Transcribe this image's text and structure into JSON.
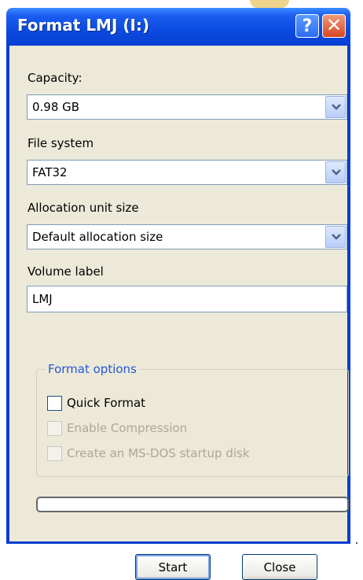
{
  "window": {
    "title": "Format LMJ (I:)",
    "help_glyph": "?",
    "close_glyph": "✕"
  },
  "capacity": {
    "label": "Capacity:",
    "value": "0.98 GB"
  },
  "file_system": {
    "label": "File system",
    "value": "FAT32"
  },
  "allocation": {
    "label": "Allocation unit size",
    "value": "Default allocation size"
  },
  "volume": {
    "label": "Volume label",
    "value": "LMJ"
  },
  "options": {
    "title": "Format options",
    "quick_format": {
      "label": "Quick Format",
      "checked": false,
      "enabled": true
    },
    "compression": {
      "label": "Enable Compression",
      "checked": false,
      "enabled": false
    },
    "msdos": {
      "label": "Create an MS-DOS startup disk",
      "checked": false,
      "enabled": false
    }
  },
  "progress": {
    "value": 0
  },
  "buttons": {
    "start": "Start",
    "close": "Close"
  },
  "colors": {
    "titlebar": "#0b4ae0",
    "client_bg": "#ece9d8",
    "group_title": "#2457d8",
    "close_button": "#d6471f"
  }
}
